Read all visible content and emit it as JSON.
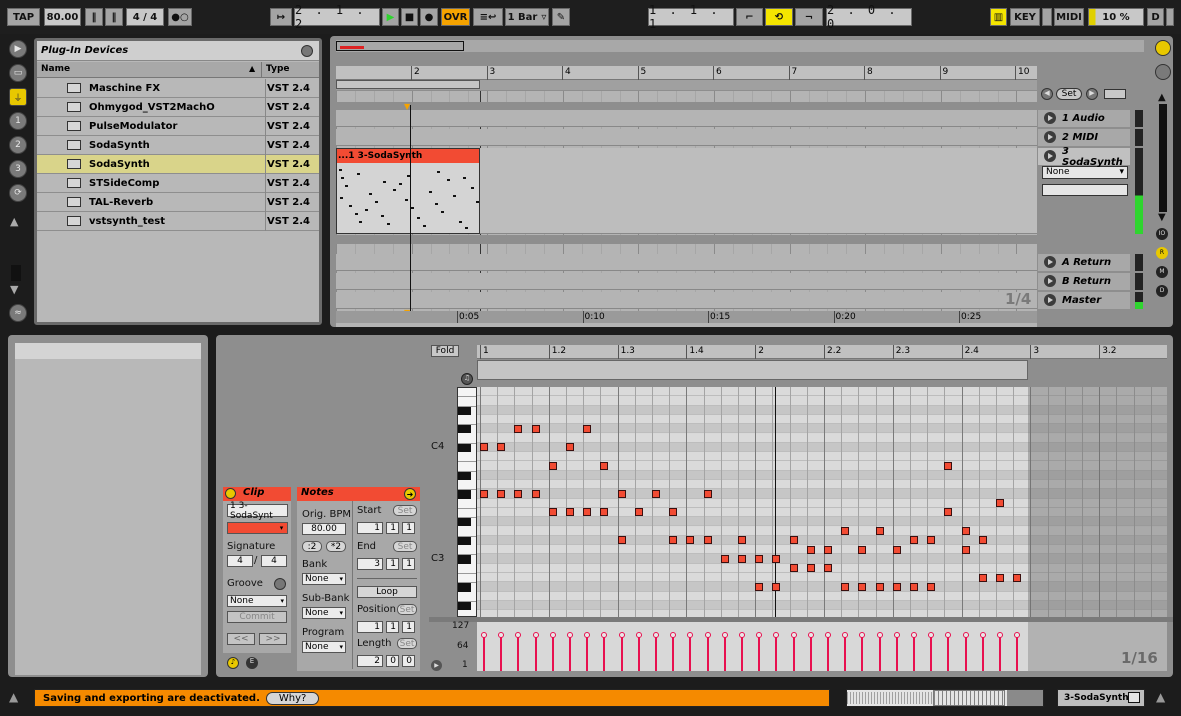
{
  "transport": {
    "tap": "TAP",
    "tempo": "80.00",
    "signature": "4 / 4",
    "position": "2 . 1 . 2",
    "ovr": "OVR",
    "quantize": "1 Bar",
    "loop_start": "1 . 1 . 1",
    "loop_length": "2 . 0 . 0",
    "key": "KEY",
    "midi": "MIDI",
    "cpu": "10 %",
    "d": "D"
  },
  "browser": {
    "title": "Plug-In Devices",
    "col_name": "Name",
    "col_type": "Type",
    "items": [
      {
        "name": "Maschine FX",
        "type": "VST 2.4"
      },
      {
        "name": "Ohmygod_VST2MachO",
        "type": "VST 2.4"
      },
      {
        "name": "PulseModulator",
        "type": "VST 2.4"
      },
      {
        "name": "SodaSynth",
        "type": "VST 2.4"
      },
      {
        "name": "SodaSynth",
        "type": "VST 2.4"
      },
      {
        "name": "STSideComp",
        "type": "VST 2.4"
      },
      {
        "name": "TAL-Reverb",
        "type": "VST 2.4"
      },
      {
        "name": "vstsynth_test",
        "type": "VST 2.4"
      }
    ]
  },
  "arrangement": {
    "ruler": [
      "2",
      "3",
      "4",
      "5",
      "6",
      "7",
      "8",
      "9",
      "10"
    ],
    "time_ruler": [
      "0:05",
      "0:10",
      "0:15",
      "0:20",
      "0:25"
    ],
    "set_label": "Set",
    "clip_name": "...1 3-SodaSynth",
    "tracks": [
      "1 Audio",
      "2 MIDI",
      "3 SodaSynth"
    ],
    "returns": [
      "A Return",
      "B Return",
      "Master"
    ],
    "input_none": "None",
    "zoom": "1/4"
  },
  "clip": {
    "title": "Clip",
    "name": "1 3-SodaSynt",
    "signature_label": "Signature",
    "sig_num": "4",
    "sig_den": "4",
    "groove_label": "Groove",
    "groove_value": "None",
    "commit": "Commit",
    "prev": "<<",
    "next": ">>"
  },
  "notes": {
    "title": "Notes",
    "orig_bpm_label": "Orig. BPM",
    "orig_bpm": "80.00",
    "half": ":2",
    "double": "*2",
    "bank_label": "Bank",
    "bank_value": "None",
    "subbank_label": "Sub-Bank",
    "subbank_value": "None",
    "program_label": "Program",
    "program_value": "None",
    "start_label": "Start",
    "end_label": "End",
    "set": "Set",
    "loop": "Loop",
    "position_label": "Position",
    "length_label": "Length",
    "start": [
      "1",
      "1",
      "1"
    ],
    "end": [
      "3",
      "1",
      "1"
    ],
    "position": [
      "1",
      "1",
      "1"
    ],
    "length": [
      "2",
      "0",
      "0"
    ]
  },
  "editor": {
    "fold": "Fold",
    "ruler": [
      "1",
      "1.2",
      "1.3",
      "1.4",
      "2",
      "2.2",
      "2.3",
      "2.4",
      "3",
      "3.2"
    ],
    "key_c4": "C4",
    "key_c3": "C3",
    "vel_max": "127",
    "vel_mid": "64",
    "vel_min": "1",
    "zoom": "1/16"
  },
  "statusbar": {
    "message": "Saving and exporting are deactivated.",
    "why": "Why?",
    "track_name": "3-SodaSynth"
  },
  "colors": {
    "clip_red": "#f24b33",
    "ovr_orange": "#f5a300",
    "status_orange": "#f58a00",
    "velocity": "#e8104f"
  }
}
